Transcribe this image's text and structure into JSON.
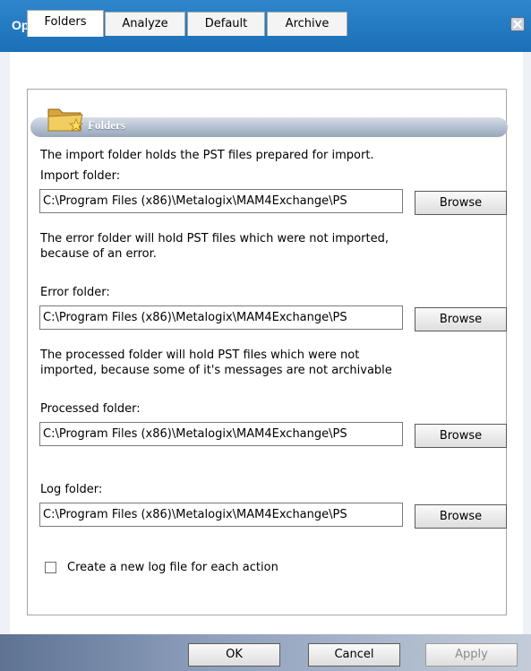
{
  "window": {
    "title": "Options"
  },
  "tabs": [
    {
      "label": "Folders",
      "active": true
    },
    {
      "label": "Analyze",
      "active": false
    },
    {
      "label": "Default",
      "active": false
    },
    {
      "label": "Archive",
      "active": false
    }
  ],
  "section": {
    "title": "Folders",
    "icon": "folder-star-icon"
  },
  "import": {
    "description": "The import folder holds the PST files prepared for import.",
    "label": "Import folder:",
    "value": "C:\\Program Files (x86)\\Metalogix\\MAM4Exchange\\PS",
    "browse_label": "Browse"
  },
  "error": {
    "description_line1": "The error folder will hold PST files which were not imported,",
    "description_line2": "because of an error.",
    "label": "Error folder:",
    "value": "C:\\Program Files (x86)\\Metalogix\\MAM4Exchange\\PS",
    "browse_label": "Browse"
  },
  "processed": {
    "description_line1": "The processed folder will hold PST files which were not",
    "description_line2": "imported, because some of it's messages are not archivable",
    "label": "Processed folder:",
    "value": "C:\\Program Files (x86)\\Metalogix\\MAM4Exchange\\PS",
    "browse_label": "Browse"
  },
  "log": {
    "label": "Log folder:",
    "value": "C:\\Program Files (x86)\\Metalogix\\MAM4Exchange\\PS",
    "browse_label": "Browse",
    "checkbox_label": "Create a new log file for each action",
    "checkbox_checked": false
  },
  "footer": {
    "ok_label": "OK",
    "cancel_label": "Cancel",
    "apply_label": "Apply"
  }
}
